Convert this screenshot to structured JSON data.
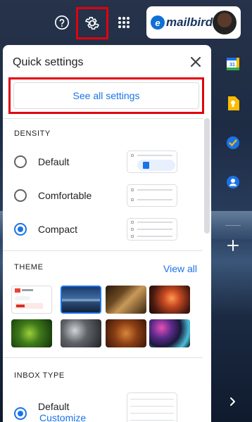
{
  "brand": {
    "name": "mailbird"
  },
  "panel": {
    "title": "Quick settings",
    "see_all_label": "See all settings",
    "density": {
      "title": "DENSITY",
      "options": [
        {
          "label": "Default",
          "selected": false
        },
        {
          "label": "Comfortable",
          "selected": false
        },
        {
          "label": "Compact",
          "selected": true
        }
      ]
    },
    "theme": {
      "title": "THEME",
      "view_all_label": "View all"
    },
    "inbox_type": {
      "title": "INBOX TYPE",
      "options": [
        {
          "label": "Default",
          "selected": true,
          "sub_label": "Customize"
        }
      ]
    }
  },
  "colors": {
    "accent": "#1a73e8",
    "highlight": "#e2000f"
  },
  "icons": [
    "help-icon",
    "settings-icon",
    "apps-icon",
    "close-icon",
    "calendar-icon",
    "keep-icon",
    "tasks-icon",
    "contacts-icon",
    "add-icon",
    "chevron-right-icon"
  ]
}
